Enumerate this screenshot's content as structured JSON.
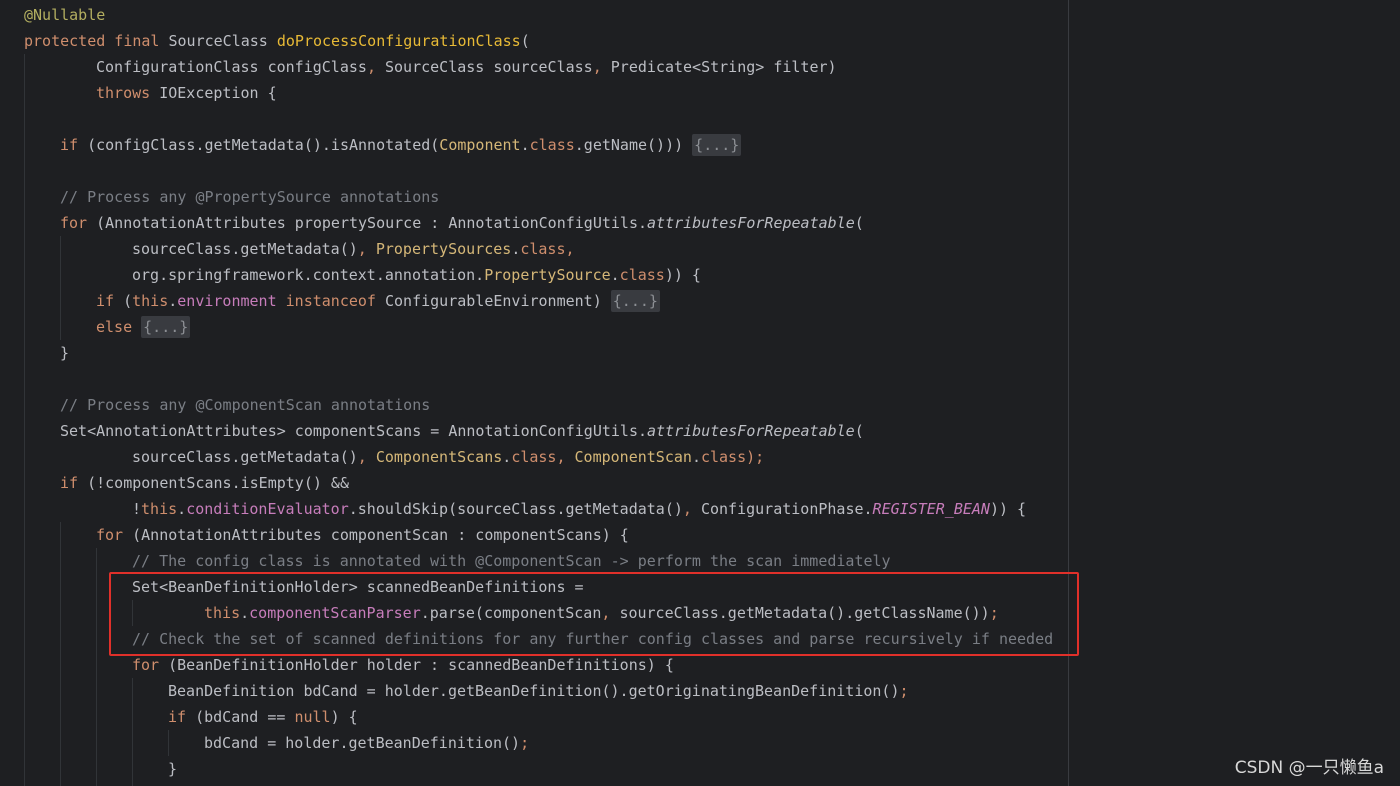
{
  "editor": {
    "theme_colors": {
      "background": "#1e1f22",
      "keyword": "#cf8e6d",
      "annotation": "#b3ae60",
      "method_declaration": "#56a8f5",
      "comment": "#7a7e85",
      "field": "#c77dbb",
      "highlight_box": "#e0302a"
    },
    "lines": [
      "@Nullable",
      "protected final SourceClass doProcessConfigurationClass(",
      "ConfigurationClass configClass, SourceClass sourceClass, Predicate<String> filter)",
      "throws IOException {",
      "",
      "if (configClass.getMetadata().isAnnotated(Component.class.getName())) {...}",
      "",
      "// Process any @PropertySource annotations",
      "for (AnnotationAttributes propertySource : AnnotationConfigUtils.attributesForRepeatable(",
      "sourceClass.getMetadata(), PropertySources.class,",
      "org.springframework.context.annotation.PropertySource.class)) {",
      "if (this.environment instanceof ConfigurableEnvironment) {...}",
      "else {...}",
      "}",
      "",
      "// Process any @ComponentScan annotations",
      "Set<AnnotationAttributes> componentScans = AnnotationConfigUtils.attributesForRepeatable(",
      "sourceClass.getMetadata(), ComponentScans.class, ComponentScan.class);",
      "if (!componentScans.isEmpty() &&",
      "!this.conditionEvaluator.shouldSkip(sourceClass.getMetadata(), ConfigurationPhase.REGISTER_BEAN)) {",
      "for (AnnotationAttributes componentScan : componentScans) {",
      "// The config class is annotated with @ComponentScan -> perform the scan immediately",
      "Set<BeanDefinitionHolder> scannedBeanDefinitions =",
      "this.componentScanParser.parse(componentScan, sourceClass.getMetadata().getClassName());",
      "// Check the set of scanned definitions for any further config classes and parse recursively if needed",
      "for (BeanDefinitionHolder holder : scannedBeanDefinitions) {",
      "BeanDefinition bdCand = holder.getBeanDefinition().getOriginatingBeanDefinition();",
      "if (bdCand == null) {",
      "bdCand = holder.getBeanDefinition();",
      "}"
    ]
  },
  "watermark": {
    "text": "CSDN @一只懒鱼a"
  }
}
